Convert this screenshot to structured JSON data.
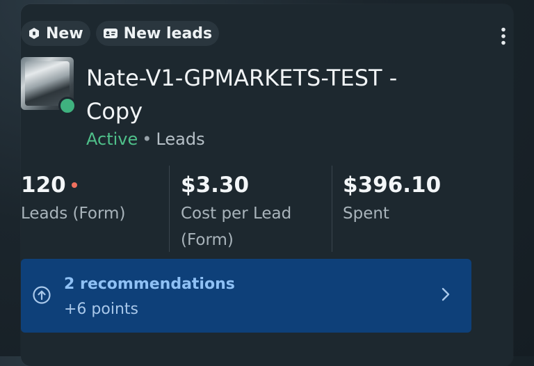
{
  "chips": [
    {
      "label": "New",
      "icon": "hexagon-badge-icon"
    },
    {
      "label": "New leads",
      "icon": "id-card-icon"
    }
  ],
  "campaign": {
    "title": "Nate-V1-GPMARKETS-TEST - Copy",
    "status": "Active",
    "separator": "•",
    "objective": "Leads",
    "status_color": "#4fc08a"
  },
  "metrics": [
    {
      "value": "120",
      "label": "Leads (Form)",
      "has_alert_dot": true
    },
    {
      "value": "$3.30",
      "label": "Cost per Lead (Form)"
    },
    {
      "value": "$396.10",
      "label": "Spent"
    }
  ],
  "recommendations": {
    "title": "2 recommendations",
    "subtitle": "+6 points",
    "background": "#0e4079"
  },
  "colors": {
    "card_bg": "#1d282f",
    "chip_bg": "#2a363e",
    "alert_dot": "#f0705e"
  }
}
